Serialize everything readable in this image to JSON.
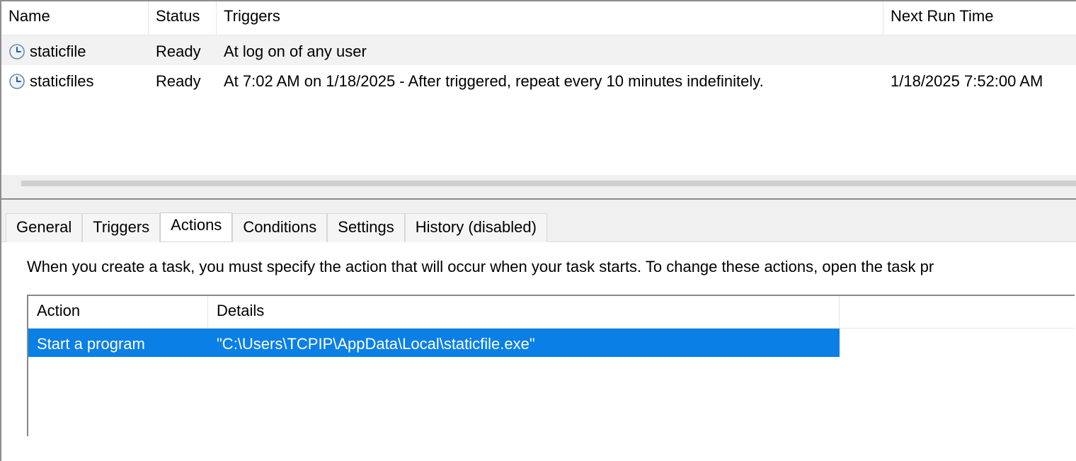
{
  "task_list": {
    "columns": {
      "name": "Name",
      "status": "Status",
      "triggers": "Triggers",
      "next_run": "Next Run Time"
    },
    "rows": [
      {
        "name": "staticfile",
        "status": "Ready",
        "triggers": "At log on of any user",
        "next_run": "",
        "selected": true
      },
      {
        "name": "staticfiles",
        "status": "Ready",
        "triggers": "At 7:02 AM on 1/18/2025 - After triggered, repeat every 10 minutes indefinitely.",
        "next_run": "1/18/2025 7:52:00 AM",
        "selected": false
      }
    ]
  },
  "tabs": {
    "general": "General",
    "triggers": "Triggers",
    "actions": "Actions",
    "conditions": "Conditions",
    "settings": "Settings",
    "history": "History (disabled)",
    "active": "actions"
  },
  "actions_tab": {
    "description": "When you create a task, you must specify the action that will occur when your task starts.  To change these actions, open the task pr",
    "columns": {
      "action": "Action",
      "details": "Details"
    },
    "rows": [
      {
        "action": "Start a program",
        "details": "\"C:\\Users\\TCPIP\\AppData\\Local\\staticfile.exe\""
      }
    ]
  }
}
